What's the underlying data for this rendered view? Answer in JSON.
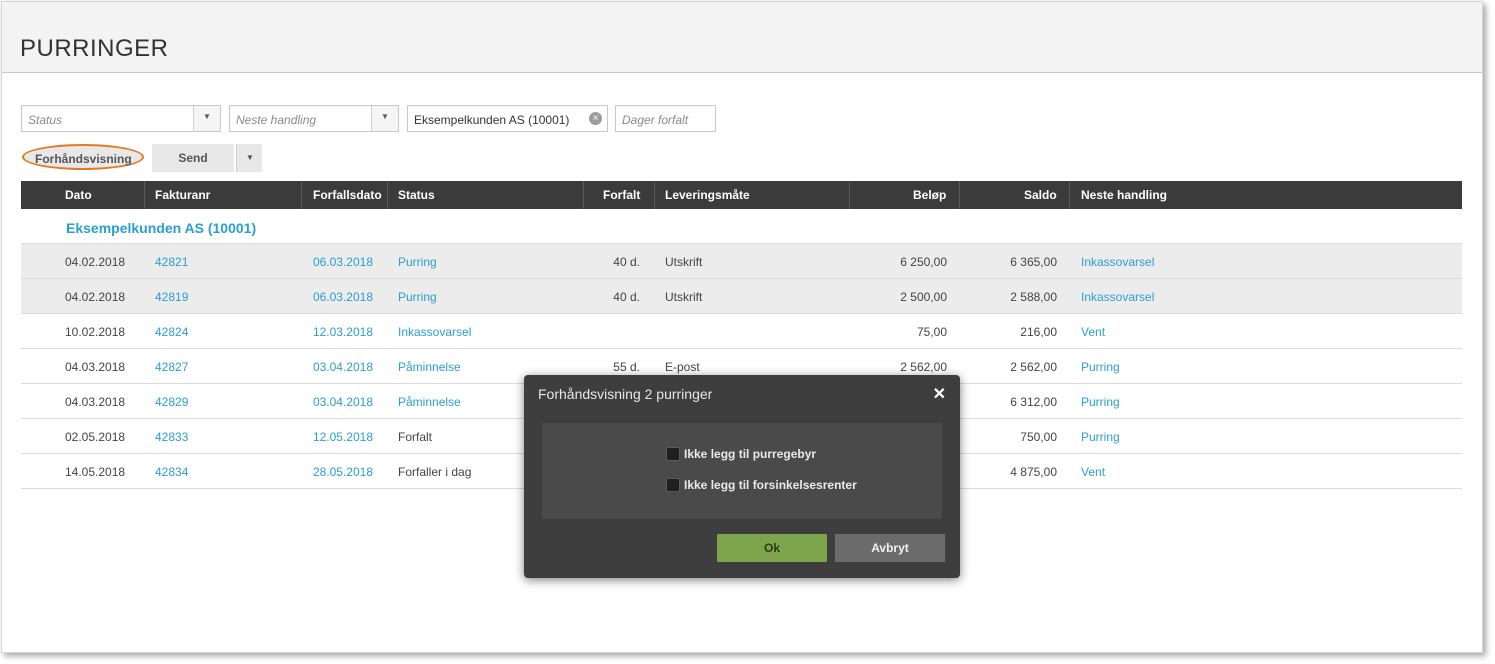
{
  "page": {
    "title": "PURRINGER"
  },
  "filters": {
    "status_placeholder": "Status",
    "next_action_placeholder": "Neste handling",
    "customer_value": "Eksempelkunden AS (10001)",
    "days_overdue_placeholder": "Dager forfalt"
  },
  "toolbar": {
    "preview_label": "Forhåndsvisning",
    "send_label": "Send"
  },
  "table": {
    "headers": {
      "date": "Dato",
      "invoice": "Fakturanr",
      "due_date": "Forfallsdato",
      "status": "Status",
      "overdue": "Forfalt",
      "delivery": "Leveringsmåte",
      "amount": "Beløp",
      "balance": "Saldo",
      "next_action": "Neste handling"
    },
    "group_label": "Eksempelkunden AS (10001)",
    "rows": [
      {
        "date": "04.02.2018",
        "invoice": "42821",
        "due_date": "06.03.2018",
        "status": "Purring",
        "overdue": "40 d.",
        "delivery": "Utskrift",
        "amount": "6 250,00",
        "balance": "6 365,00",
        "next_action": "Inkassovarsel"
      },
      {
        "date": "04.02.2018",
        "invoice": "42819",
        "due_date": "06.03.2018",
        "status": "Purring",
        "overdue": "40 d.",
        "delivery": "Utskrift",
        "amount": "2 500,00",
        "balance": "2 588,00",
        "next_action": "Inkassovarsel"
      },
      {
        "date": "10.02.2018",
        "invoice": "42824",
        "due_date": "12.03.2018",
        "status": "Inkassovarsel",
        "overdue": "",
        "delivery": "",
        "amount": "75,00",
        "balance": "216,00",
        "next_action": "Vent"
      },
      {
        "date": "04.03.2018",
        "invoice": "42827",
        "due_date": "03.04.2018",
        "status": "Påminnelse",
        "overdue": "55 d.",
        "delivery": "E-post",
        "amount": "2 562,00",
        "balance": "2 562,00",
        "next_action": "Purring"
      },
      {
        "date": "04.03.2018",
        "invoice": "42829",
        "due_date": "03.04.2018",
        "status": "Påminnelse",
        "overdue": "",
        "delivery": "",
        "amount": "",
        "balance": "6 312,00",
        "next_action": "Purring"
      },
      {
        "date": "02.05.2018",
        "invoice": "42833",
        "due_date": "12.05.2018",
        "status": "Forfalt",
        "overdue": "",
        "delivery": "",
        "amount": "",
        "balance": "750,00",
        "next_action": "Purring"
      },
      {
        "date": "14.05.2018",
        "invoice": "42834",
        "due_date": "28.05.2018",
        "status": "Forfaller i dag",
        "overdue": "",
        "delivery": "",
        "amount": "",
        "balance": "4 875,00",
        "next_action": "Vent"
      }
    ]
  },
  "modal": {
    "title": "Forhåndsvisning 2 purringer",
    "close_icon": "close-icon",
    "option_no_fee": "Ikke legg til purregebyr",
    "option_no_interest": "Ikke legg til forsinkelsesrenter",
    "ok_label": "Ok",
    "cancel_label": "Avbryt"
  },
  "colors": {
    "link": "#2a9fd0",
    "header_bg": "#3b3b3b",
    "highlight_oval": "#e27a24",
    "ok_button": "#7ca44a"
  }
}
